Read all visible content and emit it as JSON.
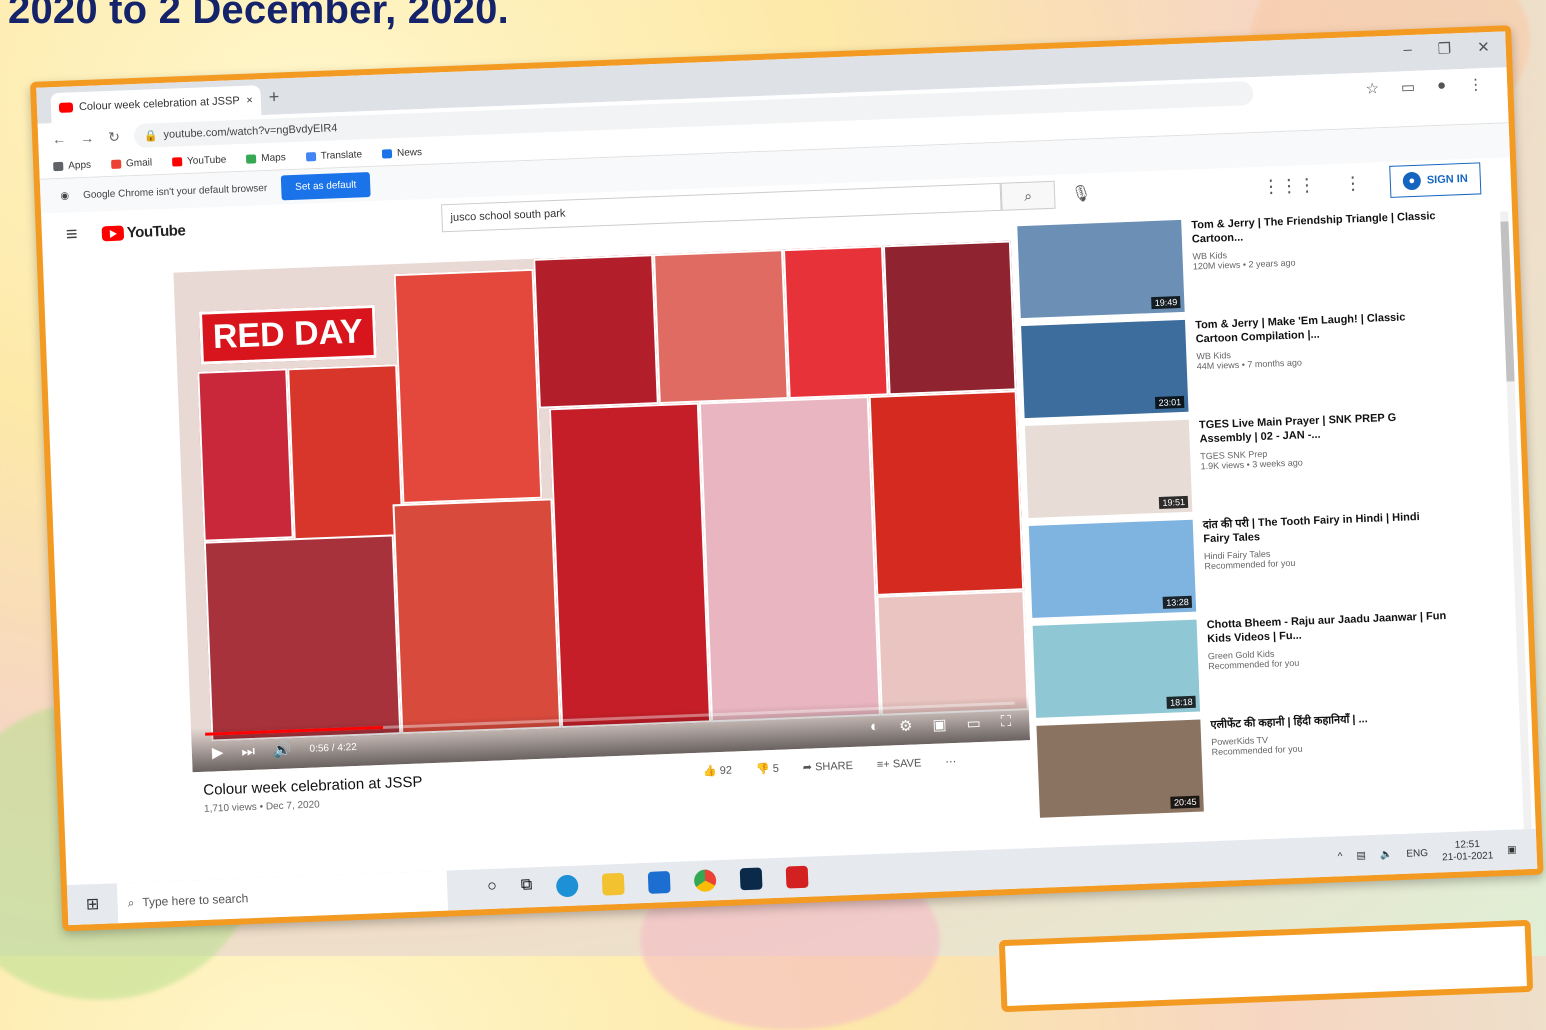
{
  "heading": "2020 to 2 December, 2020.",
  "browser": {
    "tab_title": "Colour week celebration at JSSP",
    "tab_close": "×",
    "new_tab": "+",
    "url": "youtube.com/watch?v=ngBvdyEIR4",
    "bookmarks": [
      {
        "label": "Apps",
        "color": "#5f6368"
      },
      {
        "label": "Gmail",
        "color": "#ea4335"
      },
      {
        "label": "YouTube",
        "color": "#ff0000"
      },
      {
        "label": "Maps",
        "color": "#34a853"
      },
      {
        "label": "Translate",
        "color": "#4285f4"
      },
      {
        "label": "News",
        "color": "#1a73e8"
      }
    ],
    "infobar_text": "Google Chrome isn't your default browser",
    "set_default_label": "Set as default"
  },
  "youtube": {
    "logo_text": "YouTube",
    "search_value": "jusco school south park",
    "signin_label": "SIGN IN"
  },
  "player": {
    "overlay_text": "RED DAY",
    "time": "0:56 / 4:22",
    "progress": 0.22
  },
  "video": {
    "title": "Colour week celebration at JSSP",
    "meta": "1,710 views • Dec 7, 2020",
    "likes": "92",
    "dislikes": "5",
    "share_label": "SHARE",
    "save_label": "SAVE"
  },
  "recommended": [
    {
      "title": "Tom & Jerry | The Friendship Triangle | Classic Cartoon...",
      "channel": "WB Kids",
      "views": "120M views • 2 years ago",
      "duration": "19:49",
      "color": "#6b8fb5"
    },
    {
      "title": "Tom & Jerry | Make 'Em Laugh! | Classic Cartoon Compilation |...",
      "channel": "WB Kids",
      "views": "44M views • 7 months ago",
      "duration": "23:01",
      "color": "#3c6d9c"
    },
    {
      "title": "TGES Live Main Prayer | SNK PREP G Assembly | 02 - JAN -...",
      "channel": "TGES SNK Prep",
      "views": "1.9K views • 3 weeks ago",
      "duration": "19:51",
      "color": "#e7ddd6"
    },
    {
      "title": "दांत की परी | The Tooth Fairy in Hindi | Hindi Fairy Tales",
      "channel": "Hindi Fairy Tales",
      "views": "Recommended for you",
      "duration": "13:28",
      "color": "#7fb3e0"
    },
    {
      "title": "Chotta Bheem - Raju aur Jaadu Jaanwar | Fun Kids Videos | Fu...",
      "channel": "Green Gold Kids",
      "views": "Recommended for you",
      "duration": "18:18",
      "color": "#8fc7d4"
    },
    {
      "title": "एलीफेंट की कहानी | हिंदी कहानियाँ | ...",
      "channel": "PowerKids TV",
      "views": "Recommended for you",
      "duration": "20:45",
      "color": "#8a7360"
    }
  ],
  "taskbar": {
    "search_placeholder": "Type here to search",
    "lang": "ENG",
    "time": "12:51",
    "date": "21-01-2021"
  },
  "colors": {
    "frame": "#f39a22",
    "heading": "#14236a",
    "accent_red": "#d8141c"
  }
}
